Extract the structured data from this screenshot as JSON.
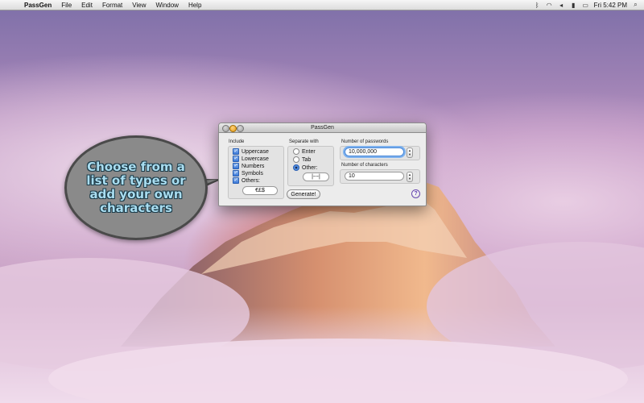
{
  "menubar": {
    "app_name": "PassGen",
    "menus": [
      "File",
      "Edit",
      "Format",
      "View",
      "Window",
      "Help"
    ],
    "clock": "Fri 5:42 PM"
  },
  "window": {
    "title": "PassGen",
    "include": {
      "label": "Include",
      "options": [
        {
          "label": "Uppercase",
          "checked": true
        },
        {
          "label": "Lowercase",
          "checked": true
        },
        {
          "label": "Numbers",
          "checked": true
        },
        {
          "label": "Symbols",
          "checked": true
        },
        {
          "label": "Others:",
          "checked": true
        }
      ],
      "others_value": "€£$"
    },
    "separate": {
      "label": "Separate with",
      "options": [
        {
          "label": "Enter",
          "selected": false
        },
        {
          "label": "Tab",
          "selected": false
        },
        {
          "label": "Other:",
          "selected": true
        }
      ],
      "other_value": "|---|"
    },
    "num_passwords": {
      "label": "Number of passwords",
      "value": "10,000,000"
    },
    "num_chars": {
      "label": "Number of characters",
      "value": "10"
    },
    "generate_label": "Generate!",
    "help_label": "?"
  },
  "callout": {
    "text": "Choose from a list of types or add your own characters"
  }
}
